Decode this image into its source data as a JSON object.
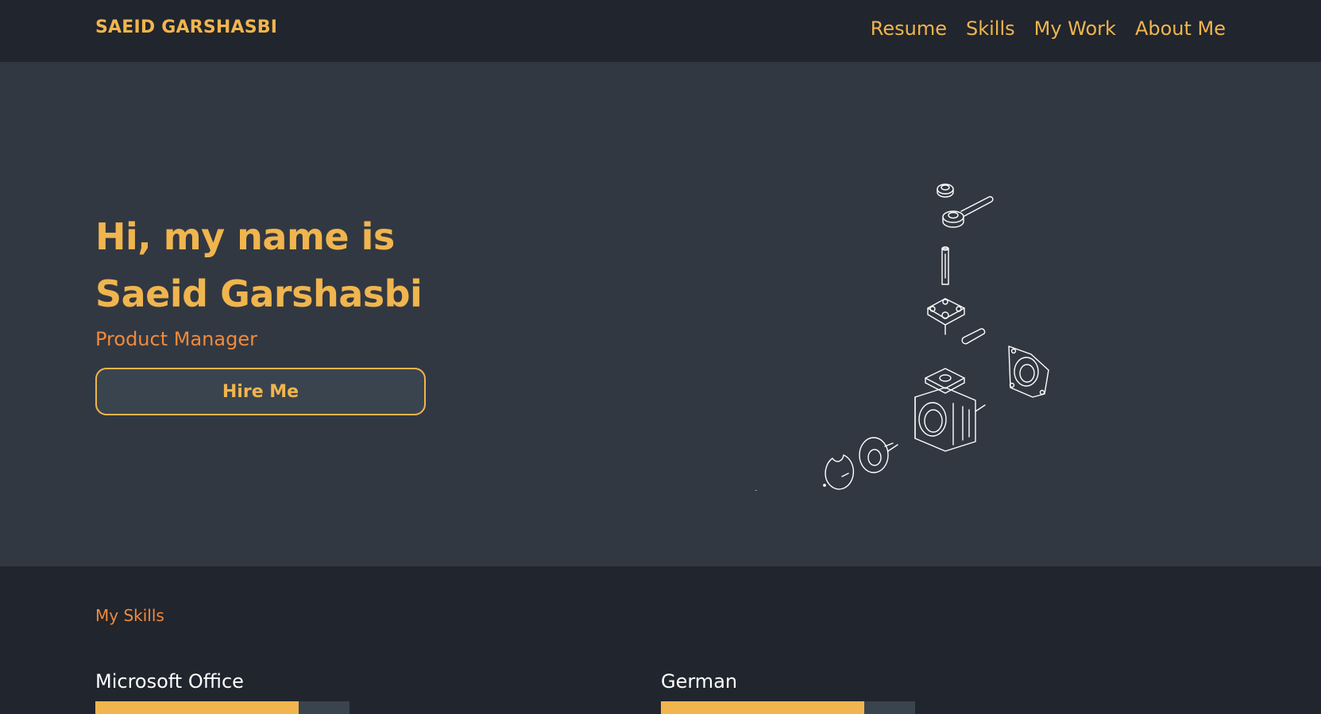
{
  "nav": {
    "brand": "SAEID GARSHASBI",
    "links": [
      "Resume",
      "Skills",
      "My Work",
      "About Me"
    ]
  },
  "hero": {
    "title_line1": "Hi, my name is",
    "title_line2": "Saeid Garshasbi",
    "role": "Product Manager",
    "cta_label": "Hire Me",
    "illustration": "exploded-valve-line-drawing"
  },
  "skills": {
    "heading": "My Skills",
    "items": [
      {
        "name": "Microsoft Office",
        "level": 0.8
      },
      {
        "name": "German",
        "level": 0.8
      }
    ]
  },
  "colors": {
    "accent": "#f0b54e",
    "accent_secondary": "#f08a3c",
    "hero_bg": "#323842",
    "nav_bg": "#21252d",
    "track_bg": "#3a444e"
  }
}
